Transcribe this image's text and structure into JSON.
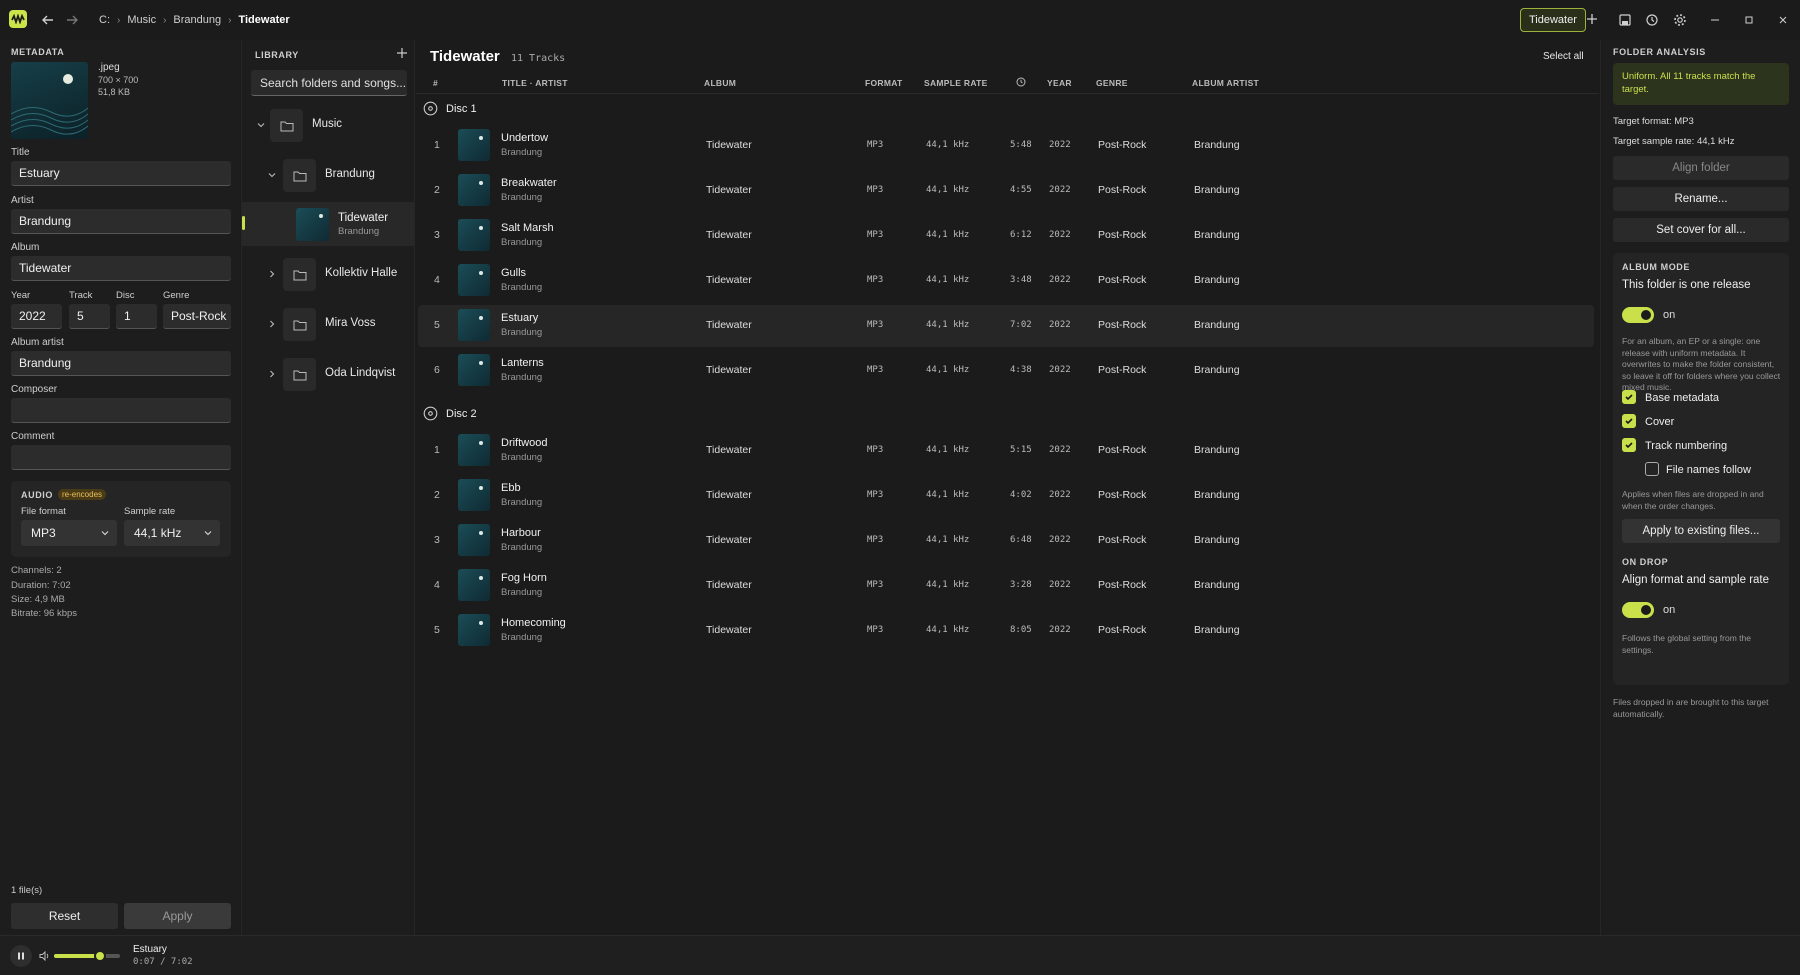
{
  "titlebar": {
    "breadcrumb": [
      "C:",
      "Music",
      "Brandung",
      "Tidewater"
    ],
    "window_tab": "Tidewater"
  },
  "metadata": {
    "section_title": "METADATA",
    "cover": {
      "ext": ".jpeg",
      "dims": "700 × 700",
      "size": "51,8 KB"
    },
    "title_label": "Title",
    "title": "Estuary",
    "artist_label": "Artist",
    "artist": "Brandung",
    "album_label": "Album",
    "album": "Tidewater",
    "year_label": "Year",
    "year": "2022",
    "track_label": "Track",
    "track": "5",
    "disc_label": "Disc",
    "disc": "1",
    "genre_label": "Genre",
    "genre": "Post-Rock",
    "album_artist_label": "Album artist",
    "album_artist": "Brandung",
    "composer_label": "Composer",
    "composer": "",
    "comment_label": "Comment",
    "comment": "",
    "audio": {
      "title": "AUDIO",
      "badge": "re-encodes",
      "format_label": "File format",
      "format": "MP3",
      "rate_label": "Sample rate",
      "rate": "44,1 kHz"
    },
    "stats": [
      "Channels: 2",
      "Duration: 7:02",
      "Size: 4,9 MB",
      "Bitrate: 96 kbps"
    ],
    "file_count": "1 file(s)",
    "reset": "Reset",
    "apply": "Apply"
  },
  "library": {
    "title": "LIBRARY",
    "search_placeholder": "Search folders and songs...",
    "items": [
      {
        "name": "Music"
      },
      {
        "name": "Brandung"
      },
      {
        "name": "Tidewater",
        "sub": "Brandung"
      },
      {
        "name": "Kollektiv Halle"
      },
      {
        "name": "Mira Voss"
      },
      {
        "name": "Oda Lindqvist"
      }
    ]
  },
  "main": {
    "title": "Tidewater",
    "count": "11 Tracks",
    "select_all": "Select all",
    "columns": [
      "#",
      "TITLE · ARTIST",
      "ALBUM",
      "FORMAT",
      "SAMPLE RATE",
      "YEAR",
      "GENRE",
      "ALBUM ARTIST"
    ],
    "discs": [
      {
        "label": "Disc 1",
        "tracks": [
          {
            "n": "1",
            "title": "Undertow",
            "artist": "Brandung",
            "album": "Tidewater",
            "format": "MP3",
            "rate": "44,1 kHz",
            "dur": "5:48",
            "year": "2022",
            "genre": "Post-Rock",
            "aa": "Brandung"
          },
          {
            "n": "2",
            "title": "Breakwater",
            "artist": "Brandung",
            "album": "Tidewater",
            "format": "MP3",
            "rate": "44,1 kHz",
            "dur": "4:55",
            "year": "2022",
            "genre": "Post-Rock",
            "aa": "Brandung"
          },
          {
            "n": "3",
            "title": "Salt Marsh",
            "artist": "Brandung",
            "album": "Tidewater",
            "format": "MP3",
            "rate": "44,1 kHz",
            "dur": "6:12",
            "year": "2022",
            "genre": "Post-Rock",
            "aa": "Brandung"
          },
          {
            "n": "4",
            "title": "Gulls",
            "artist": "Brandung",
            "album": "Tidewater",
            "format": "MP3",
            "rate": "44,1 kHz",
            "dur": "3:48",
            "year": "2022",
            "genre": "Post-Rock",
            "aa": "Brandung"
          },
          {
            "n": "5",
            "title": "Estuary",
            "artist": "Brandung",
            "album": "Tidewater",
            "format": "MP3",
            "rate": "44,1 kHz",
            "dur": "7:02",
            "year": "2022",
            "genre": "Post-Rock",
            "aa": "Brandung"
          },
          {
            "n": "6",
            "title": "Lanterns",
            "artist": "Brandung",
            "album": "Tidewater",
            "format": "MP3",
            "rate": "44,1 kHz",
            "dur": "4:38",
            "year": "2022",
            "genre": "Post-Rock",
            "aa": "Brandung"
          }
        ]
      },
      {
        "label": "Disc 2",
        "tracks": [
          {
            "n": "1",
            "title": "Driftwood",
            "artist": "Brandung",
            "album": "Tidewater",
            "format": "MP3",
            "rate": "44,1 kHz",
            "dur": "5:15",
            "year": "2022",
            "genre": "Post-Rock",
            "aa": "Brandung"
          },
          {
            "n": "2",
            "title": "Ebb",
            "artist": "Brandung",
            "album": "Tidewater",
            "format": "MP3",
            "rate": "44,1 kHz",
            "dur": "4:02",
            "year": "2022",
            "genre": "Post-Rock",
            "aa": "Brandung"
          },
          {
            "n": "3",
            "title": "Harbour",
            "artist": "Brandung",
            "album": "Tidewater",
            "format": "MP3",
            "rate": "44,1 kHz",
            "dur": "6:48",
            "year": "2022",
            "genre": "Post-Rock",
            "aa": "Brandung"
          },
          {
            "n": "4",
            "title": "Fog Horn",
            "artist": "Brandung",
            "album": "Tidewater",
            "format": "MP3",
            "rate": "44,1 kHz",
            "dur": "3:28",
            "year": "2022",
            "genre": "Post-Rock",
            "aa": "Brandung"
          },
          {
            "n": "5",
            "title": "Homecoming",
            "artist": "Brandung",
            "album": "Tidewater",
            "format": "MP3",
            "rate": "44,1 kHz",
            "dur": "8:05",
            "year": "2022",
            "genre": "Post-Rock",
            "aa": "Brandung"
          }
        ]
      }
    ],
    "selected_track": "Estuary"
  },
  "analysis": {
    "title": "FOLDER ANALYSIS",
    "status": "Uniform. All 11 tracks match the target.",
    "target_format": "Target format: MP3",
    "target_rate": "Target sample rate: 44,1 kHz",
    "align": "Align folder",
    "rename": "Rename...",
    "set_cover": "Set cover for all...",
    "album_mode": {
      "title": "ALBUM MODE",
      "heading": "This folder is one release",
      "toggle_label": "on",
      "desc": "For an album, an EP or a single: one release with uniform metadata. It overwrites to make the folder consistent, so leave it off for folders where you collect mixed music.",
      "opts": [
        {
          "label": "Base metadata",
          "checked": true
        },
        {
          "label": "Cover",
          "checked": true
        },
        {
          "label": "Track numbering",
          "checked": true
        },
        {
          "label": "File names follow",
          "checked": false
        }
      ],
      "applies": "Applies when files are dropped in and when the order changes.",
      "apply_existing": "Apply to existing files...",
      "on_drop_title": "ON DROP",
      "on_drop_heading": "Align format and sample rate",
      "on_drop_toggle": "on",
      "on_drop_desc": "Follows the global setting from the settings."
    },
    "footer": "Files dropped in are brought to this target automatically."
  },
  "player": {
    "title": "Estuary",
    "time": "0:07 / 7:02",
    "volume": 0.7
  },
  "colors": {
    "accent": "#c9e04b",
    "bg": "#1b1b1b"
  }
}
